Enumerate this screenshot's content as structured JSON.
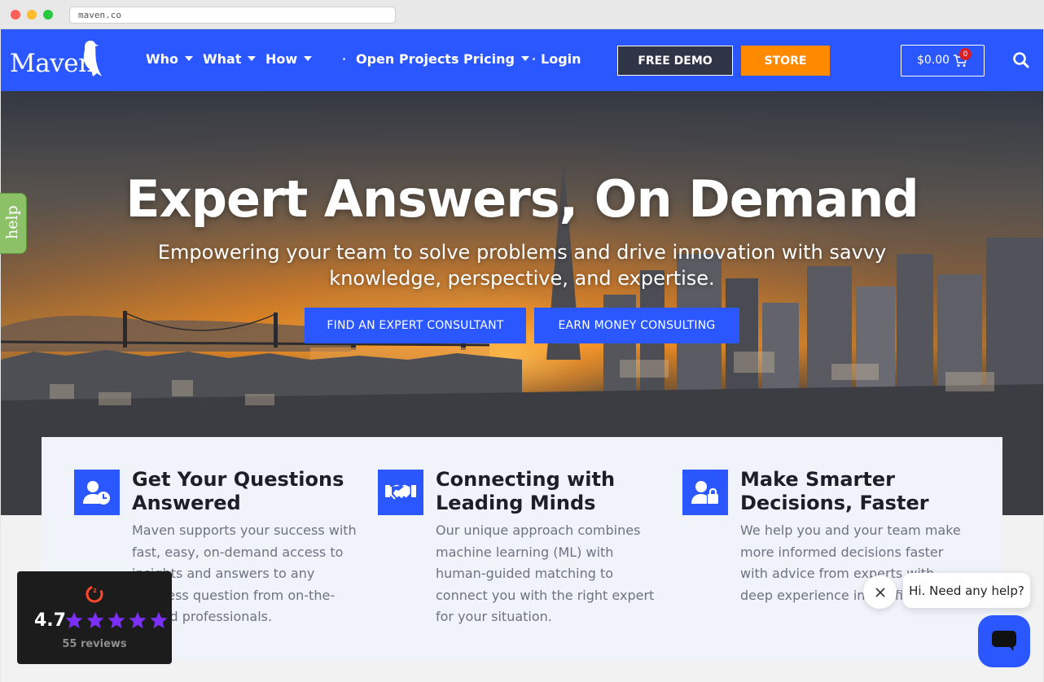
{
  "browser": {
    "url": "maven.co"
  },
  "nav": {
    "logo": "Maven",
    "items": [
      {
        "label": "Who",
        "dropdown": true
      },
      {
        "label": "What",
        "dropdown": true
      },
      {
        "label": "How",
        "dropdown": true
      },
      {
        "label": "Open Projects",
        "dropdown": false
      },
      {
        "label": "Pricing",
        "dropdown": true
      },
      {
        "label": "Login",
        "dropdown": false
      }
    ],
    "demo_label": "FREE DEMO",
    "store_label": "STORE",
    "cart_amount": "$0.00",
    "cart_count": "0"
  },
  "hero": {
    "title": "Expert Answers, On Demand",
    "subtitle": "Empowering your team to solve problems and drive innovation with savvy knowledge, perspective, and expertise.",
    "btn_find": "FIND AN EXPERT CONSULTANT",
    "btn_earn": "EARN MONEY CONSULTING"
  },
  "help_tab": "help",
  "features": [
    {
      "icon": "user-clock-icon",
      "title": "Get Your Questions Answered",
      "text": "Maven supports your success with fast, easy, on-demand access to insights and answers to any business question from on-the-ground professionals."
    },
    {
      "icon": "handshake-icon",
      "title": "Connecting with Leading Minds",
      "text": "Our unique approach combines machine learning (ML) with human-guided matching to connect you with the right expert for your situation."
    },
    {
      "icon": "user-lock-icon",
      "title": "Make Smarter Decisions, Faster",
      "text": "We help you and your team make more informed decisions faster with advice from experts with deep experience in the field."
    }
  ],
  "g2": {
    "rating": "4.7",
    "reviews": "55 reviews",
    "stars": 5
  },
  "chat": {
    "greeting": "Hi. Need any help?"
  },
  "colors": {
    "brand_blue": "#2a57ff",
    "store_orange": "#ff8a00",
    "demo_dark": "#2f3447",
    "g2_purple": "#7b2ff7"
  }
}
